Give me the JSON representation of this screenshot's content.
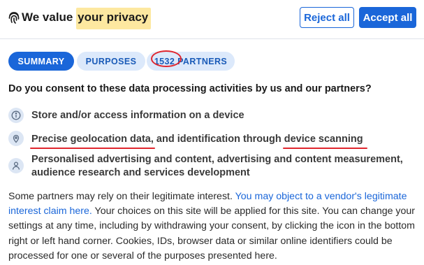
{
  "header": {
    "title_prefix": "We value",
    "title_highlight": "your privacy",
    "reject_label": "Reject all",
    "accept_label": "Accept all"
  },
  "tabs": {
    "summary": "SUMMARY",
    "purposes": "PURPOSES",
    "partners_count": "1532",
    "partners_label": "PARTNERS"
  },
  "question": "Do you consent to these data processing activities by us and our partners?",
  "purposes": {
    "storage": "Store and/or access information on a device",
    "geo_a": "Precise geolocation data",
    "geo_b": ", and identification through ",
    "geo_c": "device scanning",
    "ads_line1": "Personalised advertising and content, advertising and content measurement,",
    "ads_line2": "audience research and services development"
  },
  "paragraph": {
    "lead": "Some partners may rely on their legitimate interest. ",
    "link": "You may object to a vendor's legitimate interest claim here.",
    "tail": " Your choices on this site will be applied for this site. You can change your settings at any time, including by withdrawing your consent, by clicking the icon in the bottom right or left hand corner. Cookies, IDs, browser data or similar online identifiers could be processed for one or several of the purposes presented here."
  },
  "colors": {
    "accent": "#1a66d9",
    "tab_bg": "#dce9fb",
    "highlight": "#fde8a0",
    "annotation": "#e0262e"
  },
  "icons": [
    "fingerprint-icon",
    "info-icon",
    "location-pin-icon",
    "person-icon"
  ]
}
